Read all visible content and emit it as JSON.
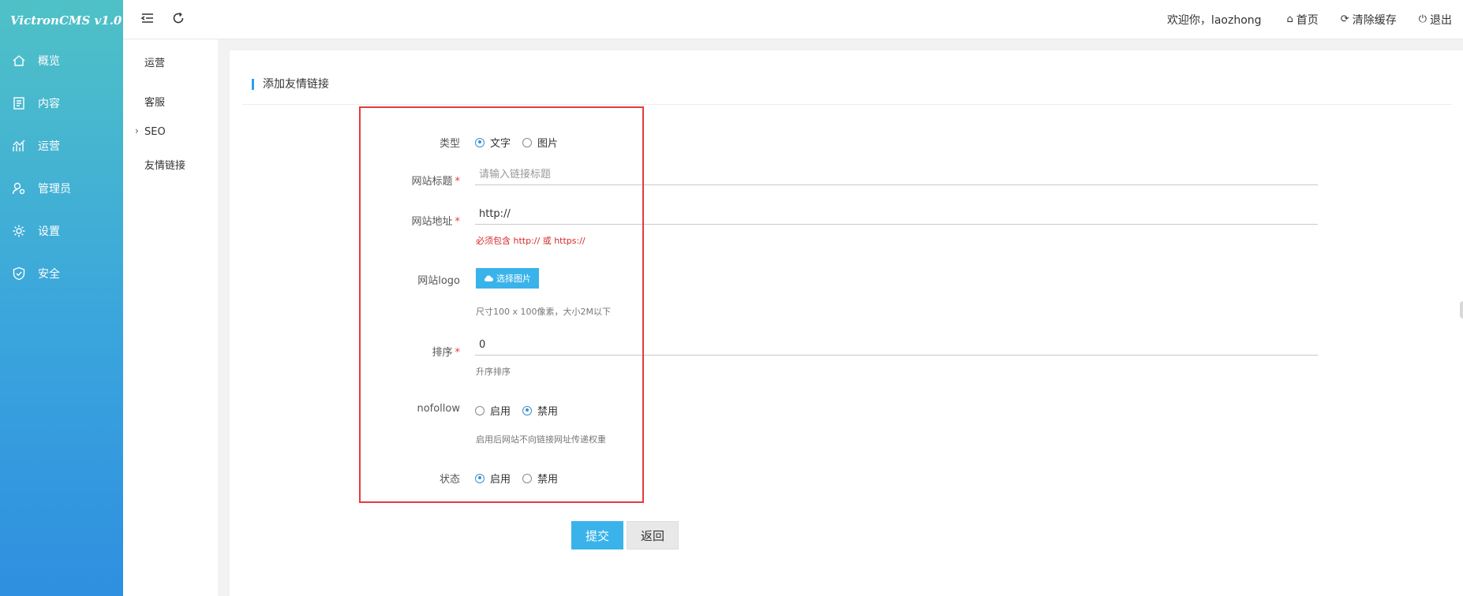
{
  "app": {
    "brand": "VictronCMS v1.0"
  },
  "nav": [
    {
      "label": "概览",
      "icon": "home-icon"
    },
    {
      "label": "内容",
      "icon": "document-icon"
    },
    {
      "label": "运营",
      "icon": "chart-icon"
    },
    {
      "label": "管理员",
      "icon": "user-gear-icon"
    },
    {
      "label": "设置",
      "icon": "gear-icon"
    },
    {
      "label": "安全",
      "icon": "shield-icon"
    }
  ],
  "submenu": [
    {
      "label": "运营"
    },
    {
      "label": "客服"
    },
    {
      "label": "SEO"
    },
    {
      "label": "友情链接"
    }
  ],
  "topbar": {
    "welcome": "欢迎你，laozhong",
    "home": "首页",
    "clear_cache": "清除缓存",
    "logout": "退出"
  },
  "page": {
    "title": "添加友情链接"
  },
  "form": {
    "type": {
      "label": "类型",
      "options": [
        "文字",
        "图片"
      ],
      "selected": "文字"
    },
    "title": {
      "label": "网站标题",
      "placeholder": "请输入链接标题",
      "value": ""
    },
    "url": {
      "label": "网站地址",
      "value": "http://",
      "hint": "必须包含 http:// 或 https://"
    },
    "logo": {
      "label": "网站logo",
      "button": "选择图片",
      "hint": "尺寸100 x 100像素，大小2M以下"
    },
    "sort": {
      "label": "排序",
      "value": "0",
      "hint": "升序排序"
    },
    "nofollow": {
      "label": "nofollow",
      "options": [
        "启用",
        "禁用"
      ],
      "selected": "禁用",
      "hint": "启用后网站不向链接网址传递权重"
    },
    "status": {
      "label": "状态",
      "options": [
        "启用",
        "禁用"
      ],
      "selected": "启用"
    },
    "required_mark": "*"
  },
  "actions": {
    "submit": "提交",
    "back": "返回"
  },
  "colors": {
    "accent": "#3ab3ea",
    "highlight": "#e23c3c",
    "error": "#d42a2a"
  }
}
